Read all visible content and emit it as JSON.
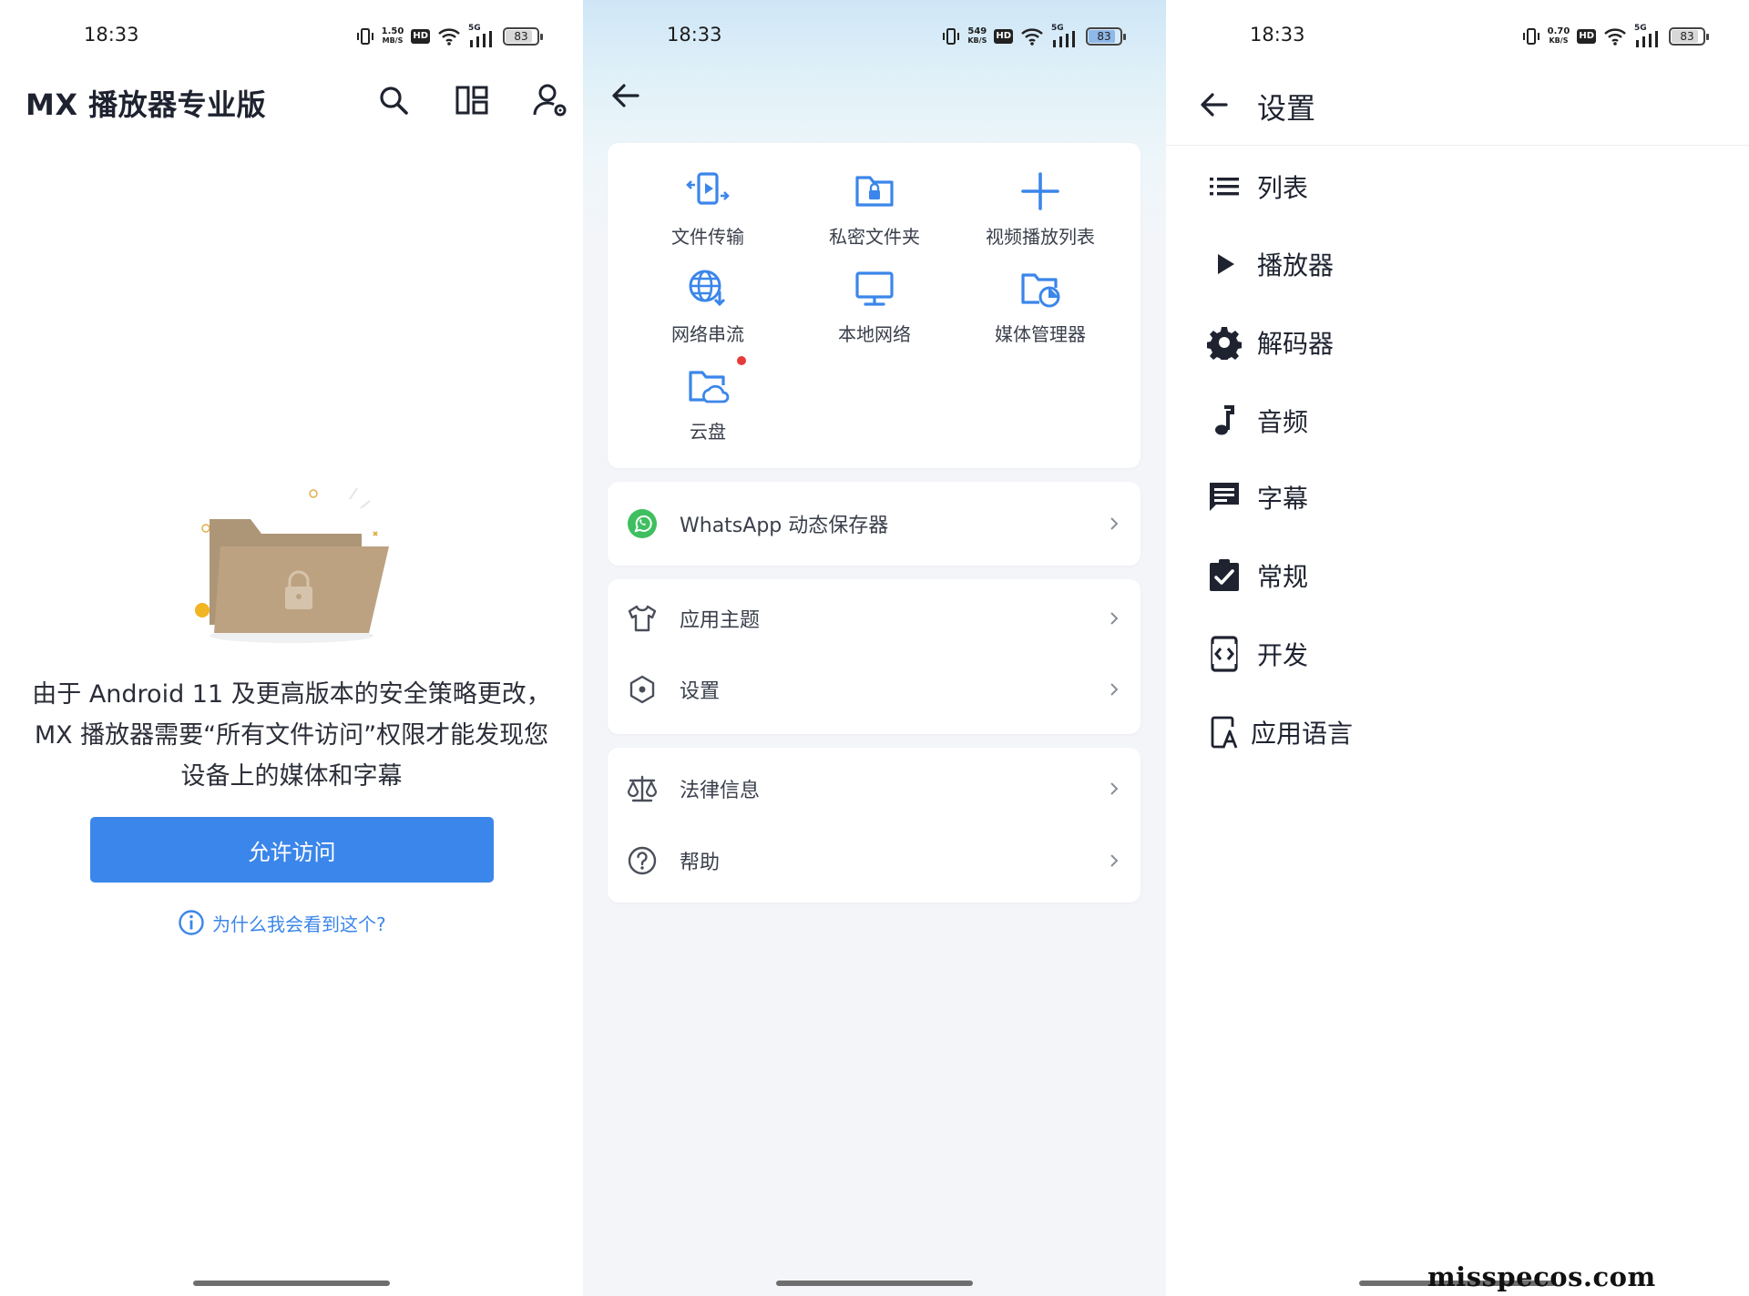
{
  "status_bars": [
    {
      "time": "18:33",
      "speed": "1.50",
      "speed_unit": "MB/S",
      "network": "5G",
      "battery": "83"
    },
    {
      "time": "18:33",
      "speed": "549",
      "speed_unit": "KB/S",
      "network": "5G",
      "battery": "83"
    },
    {
      "time": "18:33",
      "speed": "0.70",
      "speed_unit": "KB/S",
      "network": "5G",
      "battery": "83"
    }
  ],
  "hd_label": "HD",
  "panel1": {
    "title": "MX 播放器专业版",
    "actions": [
      "search-icon",
      "layout-icon",
      "account-settings-icon"
    ],
    "message": "由于 Android 11 及更高版本的安全策略更改，MX 播放器需要“所有文件访问”权限才能发现您设备上的媒体和字幕",
    "allow_button": "允许访问",
    "why_link": "为什么我会看到这个?"
  },
  "panel2": {
    "grid": [
      {
        "label": "文件传输",
        "icon": "file-transfer-icon"
      },
      {
        "label": "私密文件夹",
        "icon": "private-folder-icon"
      },
      {
        "label": "视频播放列表",
        "icon": "add-playlist-icon"
      },
      {
        "label": "网络串流",
        "icon": "network-stream-icon"
      },
      {
        "label": "本地网络",
        "icon": "local-network-icon"
      },
      {
        "label": "媒体管理器",
        "icon": "media-manager-icon"
      },
      {
        "label": "云盘",
        "icon": "cloud-drive-icon",
        "badge": true
      }
    ],
    "whatsapp": "WhatsApp 动态保存器",
    "group2": [
      {
        "label": "应用主题",
        "icon": "shirt-icon"
      },
      {
        "label": "设置",
        "icon": "settings-hex-icon"
      }
    ],
    "group3": [
      {
        "label": "法律信息",
        "icon": "scales-icon"
      },
      {
        "label": "帮助",
        "icon": "help-icon"
      }
    ]
  },
  "panel3": {
    "title": "设置",
    "items": [
      {
        "label": "列表",
        "icon": "list-icon"
      },
      {
        "label": "播放器",
        "icon": "play-icon"
      },
      {
        "label": "解码器",
        "icon": "gear-icon"
      },
      {
        "label": "音频",
        "icon": "music-note-icon"
      },
      {
        "label": "字幕",
        "icon": "subtitle-icon"
      },
      {
        "label": "常规",
        "icon": "clipboard-check-icon"
      },
      {
        "label": "开发",
        "icon": "developer-icon"
      },
      {
        "label": "应用语言",
        "icon": "app-language-icon"
      }
    ]
  },
  "colors": {
    "accent": "#3b86ea",
    "whatsapp": "#3fbf5f",
    "text": "#1f2330"
  },
  "watermark": "misspecos.com"
}
